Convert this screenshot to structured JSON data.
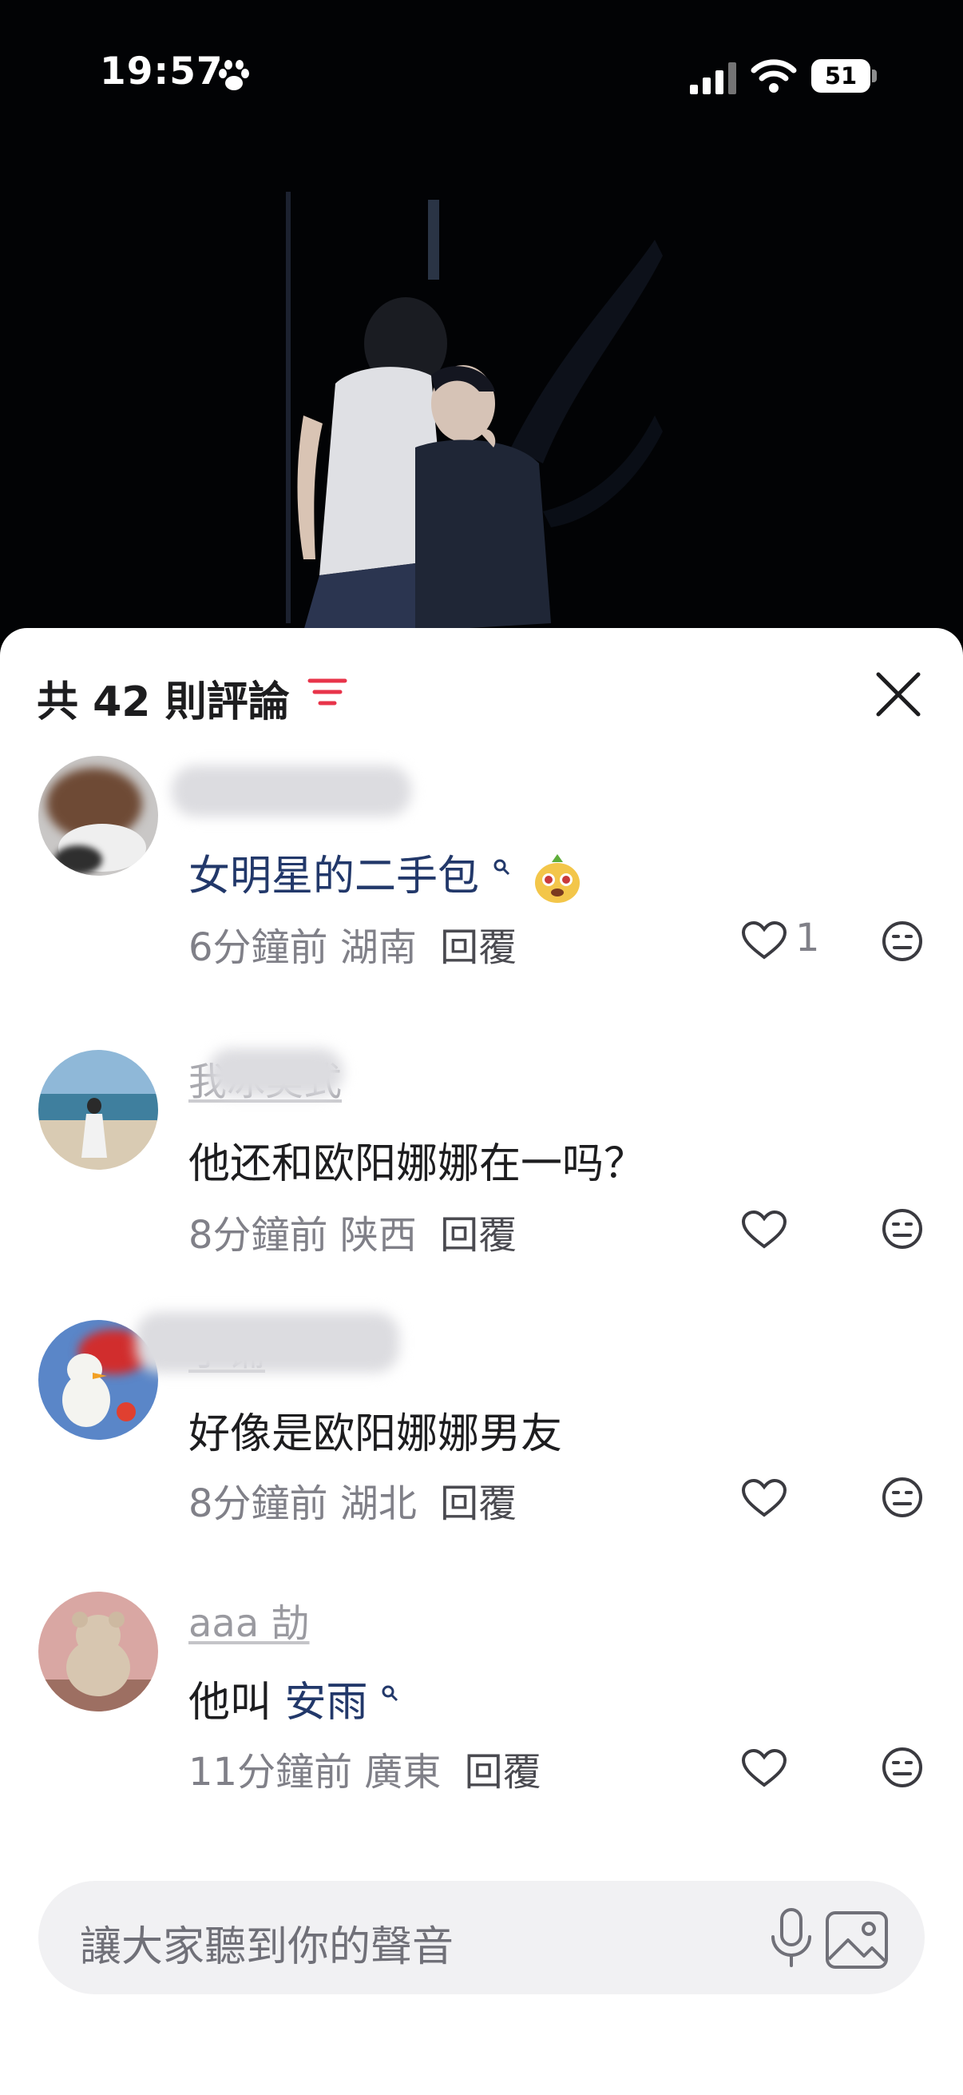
{
  "status_bar": {
    "time": "19:57",
    "battery": "51",
    "icons": [
      "paw-icon",
      "signal-icon",
      "wifi-icon",
      "battery-icon"
    ]
  },
  "comments_sheet": {
    "title": "共 42 則評論",
    "accent_color": "#e8344a",
    "link_color": "#22386a"
  },
  "comments": [
    {
      "username": "",
      "text_link": "女明星的二手包",
      "emoji": "mascot-emoji",
      "time": "6分鐘前",
      "location": "湖南",
      "reply": "回覆",
      "likes": "1"
    },
    {
      "username": "我冰美式",
      "text": "他还和欧阳娜娜在一吗？",
      "time": "8分鐘前",
      "location": "陕西",
      "reply": "回覆"
    },
    {
      "username": "于铺",
      "text": "好像是欧阳娜娜男友",
      "time": "8分鐘前",
      "location": "湖北",
      "reply": "回覆"
    },
    {
      "username": "aaa 劼",
      "text_prefix": "他叫 ",
      "text_link": "安雨",
      "time": "11分鐘前",
      "location": "廣東",
      "reply": "回覆"
    }
  ],
  "input": {
    "placeholder": "讓大家聽到你的聲音"
  }
}
